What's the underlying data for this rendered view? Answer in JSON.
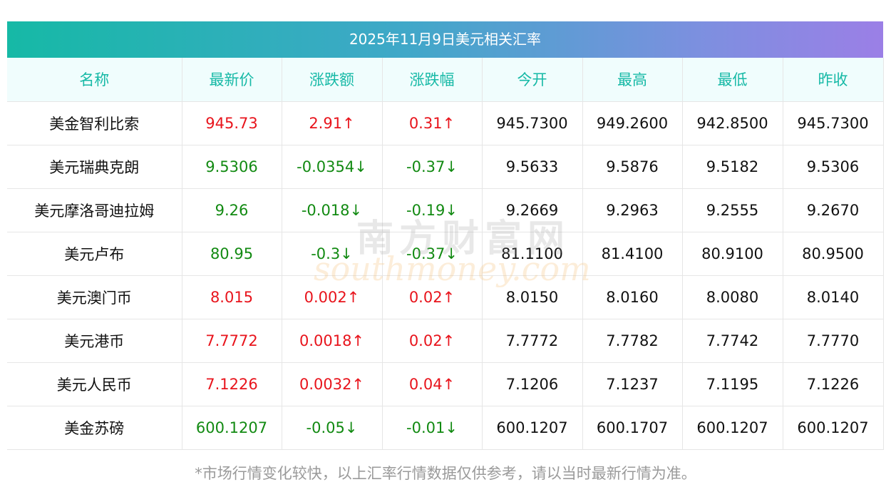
{
  "title": "2025年11月9日美元相关汇率",
  "headers": [
    "名称",
    "最新价",
    "涨跌额",
    "涨跌幅",
    "今开",
    "最高",
    "最低",
    "昨收"
  ],
  "rows": [
    {
      "name": "美金智利比索",
      "latest": "945.73",
      "change": "2.91↑",
      "change_pct": "0.31↑",
      "open": "945.7300",
      "high": "949.2600",
      "low": "942.8500",
      "prev_close": "945.7300",
      "trend": "up"
    },
    {
      "name": "美元瑞典克朗",
      "latest": "9.5306",
      "change": "-0.0354↓",
      "change_pct": "-0.37↓",
      "open": "9.5633",
      "high": "9.5876",
      "low": "9.5182",
      "prev_close": "9.5306",
      "trend": "down"
    },
    {
      "name": "美元摩洛哥迪拉姆",
      "latest": "9.26",
      "change": "-0.018↓",
      "change_pct": "-0.19↓",
      "open": "9.2669",
      "high": "9.2963",
      "low": "9.2555",
      "prev_close": "9.2670",
      "trend": "down"
    },
    {
      "name": "美元卢布",
      "latest": "80.95",
      "change": "-0.3↓",
      "change_pct": "-0.37↓",
      "open": "81.1100",
      "high": "81.4100",
      "low": "80.9100",
      "prev_close": "80.9500",
      "trend": "down"
    },
    {
      "name": "美元澳门币",
      "latest": "8.015",
      "change": "0.002↑",
      "change_pct": "0.02↑",
      "open": "8.0150",
      "high": "8.0160",
      "low": "8.0080",
      "prev_close": "8.0140",
      "trend": "up"
    },
    {
      "name": "美元港币",
      "latest": "7.7772",
      "change": "0.0018↑",
      "change_pct": "0.02↑",
      "open": "7.7772",
      "high": "7.7782",
      "low": "7.7742",
      "prev_close": "7.7770",
      "trend": "up"
    },
    {
      "name": "美元人民币",
      "latest": "7.1226",
      "change": "0.0032↑",
      "change_pct": "0.04↑",
      "open": "7.1206",
      "high": "7.1237",
      "low": "7.1195",
      "prev_close": "7.1226",
      "trend": "up"
    },
    {
      "name": "美金苏磅",
      "latest": "600.1207",
      "change": "-0.05↓",
      "change_pct": "-0.01↓",
      "open": "600.1207",
      "high": "600.1707",
      "low": "600.1207",
      "prev_close": "600.1207",
      "trend": "down"
    }
  ],
  "watermark": {
    "cn": "南方财富网",
    "en": "southmoney.com"
  },
  "footnote": "*市场行情变化较快，以上汇率行情数据仅供参考，请以当时最新行情为准。",
  "colors": {
    "up": "#e8141c",
    "down": "#128a12",
    "header_text": "#16b9a6"
  }
}
